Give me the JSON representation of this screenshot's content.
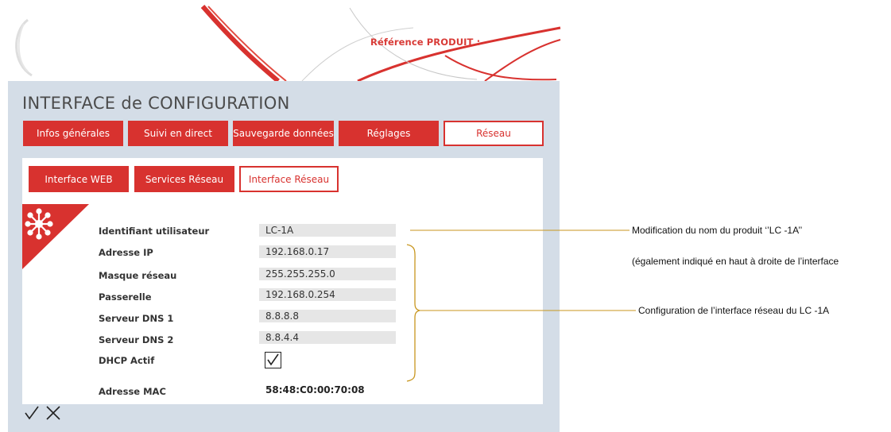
{
  "header": {
    "reference_label": "Référence  PRODUIT :",
    "logo_icon": "product-logo"
  },
  "page_title": "INTERFACE de CONFIGURATION",
  "tabs": [
    {
      "label": "Infos générales",
      "active": false
    },
    {
      "label": "Suivi en direct",
      "active": false
    },
    {
      "label": "Sauvegarde données",
      "active": false
    },
    {
      "label": "Réglages",
      "active": false
    },
    {
      "label": "Réseau",
      "active": true
    }
  ],
  "subtabs": [
    {
      "label": "Interface WEB",
      "active": false
    },
    {
      "label": "Services Réseau",
      "active": false
    },
    {
      "label": "Interface Réseau",
      "active": true
    }
  ],
  "section_icon": "network-hub-icon",
  "fields": [
    {
      "label": "Identifiant utilisateur",
      "value": "LC-1A"
    },
    {
      "label": "Adresse IP",
      "value": "192.168.0.17"
    },
    {
      "label": "Masque réseau",
      "value": "255.255.255.0"
    },
    {
      "label": "Passerelle",
      "value": "192.168.0.254"
    },
    {
      "label": "Serveur DNS 1",
      "value": "8.8.8.8"
    },
    {
      "label": "Serveur DNS 2",
      "value": "8.8.4.4"
    }
  ],
  "dhcp": {
    "label": "DHCP Actif",
    "checked": true
  },
  "mac": {
    "label": "Adresse MAC",
    "value": "58:48:C0:00:70:08"
  },
  "actions": {
    "confirm_icon": "check-icon",
    "cancel_icon": "close-icon"
  },
  "annotations": {
    "name_change": "Modification du nom du produit ‘’LC -1A’’",
    "name_change_note": "(également indiqué en haut à droite de l’interface",
    "network_config": "Configuration de l’interface réseau du LC -1A"
  },
  "colors": {
    "accent": "#d8322f",
    "panel": "#d4dde7",
    "annotation_line": "#c8961e"
  }
}
